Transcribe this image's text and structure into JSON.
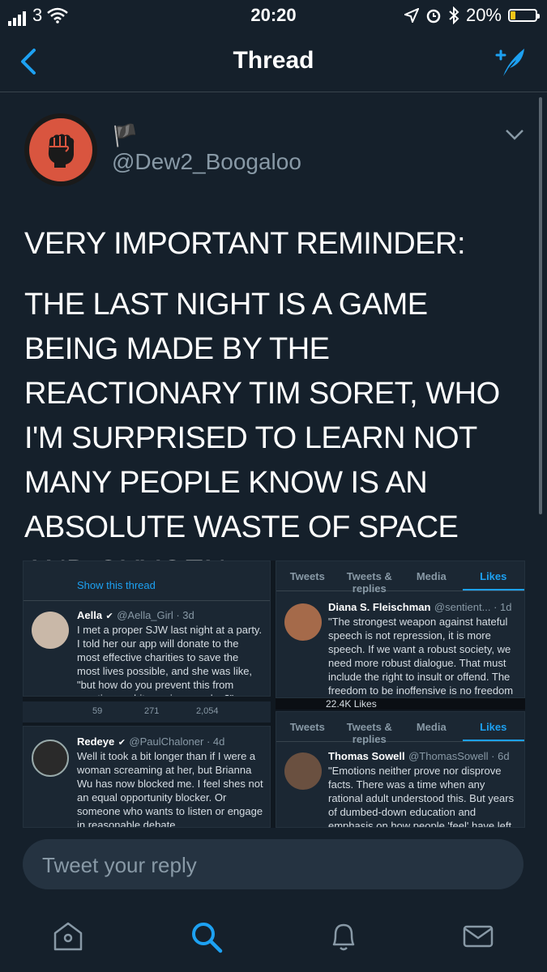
{
  "status": {
    "carrier": "3",
    "time": "20:20",
    "battery": "20%",
    "battery_level": 0.2
  },
  "nav": {
    "title": "Thread"
  },
  "tweet": {
    "display_name_flag": "🏴",
    "handle": "@Dew2_Boogaloo",
    "paragraphs": [
      "VERY IMPORTANT REMINDER:",
      "THE LAST NIGHT IS A GAME BEING MADE BY THE REACTIONARY TIM SORET, WHO I'M SURPRISED TO LEARN NOT MANY PEOPLE KNOW IS AN ABSOLUTE WASTE OF SPACE AND OXYGEN"
    ]
  },
  "embed": {
    "show_thread": "Show this thread",
    "aella": {
      "name": "Aella",
      "handle_time": "@Aella_Girl · 3d",
      "text": "I met a proper SJW last night at a party. I told her our app will donate to the most effective charities to save the most lives possible, and she was like, \"but how do you prevent this from creating a white savior complex?\""
    },
    "stats": {
      "replies": "59",
      "retweets": "271",
      "likes": "2,054"
    },
    "redeye": {
      "name": "Redeye",
      "handle_time": "@PaulChaloner · 4d",
      "text": "Well it took a bit longer than if I were a woman screaming at her, but Brianna Wu has now blocked me. I feel shes not an equal opportunity blocker. Or someone who wants to listen or engage in reasonable debate."
    },
    "tabs": [
      "Tweets",
      "Tweets & replies",
      "Media",
      "Likes"
    ],
    "diana": {
      "name": "Diana S. Fleischman",
      "handle_time": "@sentient... · 1d",
      "text": "\"The strongest weapon against hateful speech is not repression, it is more speech. If we want a robust society, we need more robust dialogue. That must include the right to insult or offend. The freedom to be inoffensive is no freedom"
    },
    "likes_count": "22.4K Likes",
    "sowell": {
      "name": "Thomas Sowell",
      "handle_time": "@ThomasSowell · 6d",
      "text": "\"Emotions neither prove nor disprove facts. There was a time when any rational adult understood this. But years of dumbed-down education and emphasis on how people 'feel' have left"
    }
  },
  "reply": {
    "placeholder": "Tweet your reply"
  },
  "colors": {
    "background": "#15202b",
    "accent": "#1da1f2",
    "muted": "#8899a6",
    "divider": "#38444d"
  }
}
